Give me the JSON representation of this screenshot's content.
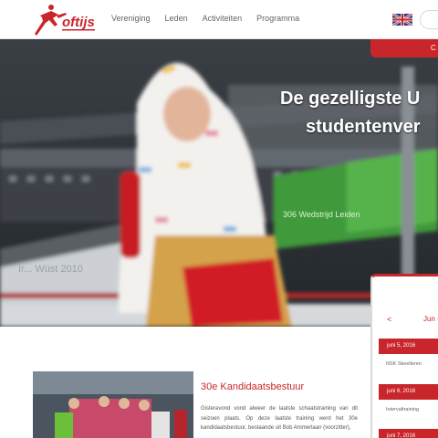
{
  "header": {
    "logo_text": "oftijs",
    "nav": [
      {
        "label": "Vereniging"
      },
      {
        "label": "Leden"
      },
      {
        "label": "Activiteiten"
      },
      {
        "label": "Programma"
      }
    ],
    "language_flag": "uk-flag-icon"
  },
  "hero": {
    "tab_label": "C",
    "title_line1": "De gezelligste U",
    "title_line2": "studentenver",
    "banner_text": "Ir... Wüst 2010",
    "board_text": "306 Wedstrijd Leiden"
  },
  "article": {
    "title": "30e Kandidaatsbestuur",
    "text": "Gisteravond vond alweer de laatste schaatstraining van dit seizoen plaats. Op deze laatste training werd het 30e kandidaatsbestuur, bestaande uit Bob Ammerlaan (voorzitter),"
  },
  "calendar": {
    "prev": "<",
    "month": "Jun -",
    "events": [
      {
        "date": "juni 5, 2016",
        "title": "NSK Skeelleren"
      },
      {
        "date": "juni 6, 2016",
        "title": "Intervaltraining"
      },
      {
        "date": "juni 7, 2016",
        "title": ""
      }
    ]
  },
  "colors": {
    "brand_red": "#c9262b",
    "nav_text": "#666666"
  }
}
